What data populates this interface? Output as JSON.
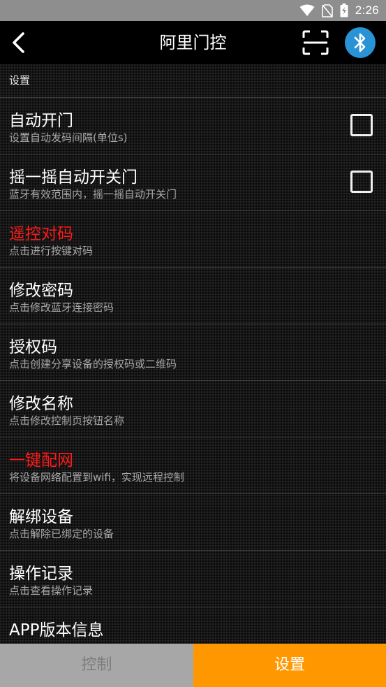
{
  "status_bar": {
    "time": "2:26",
    "icons": [
      "wifi-icon",
      "no-sim-icon",
      "battery-charging-icon"
    ]
  },
  "app_bar": {
    "title": "阿里门控",
    "back_icon": "back-arrow-icon",
    "scan_icon": "scan-icon",
    "bluetooth_icon": "bluetooth-icon"
  },
  "colors": {
    "accent_orange": "#ff9800",
    "bluetooth_blue": "#2a93d5",
    "highlight_red": "#ff1a1a"
  },
  "settings": {
    "section_label": "设置",
    "rows": [
      {
        "title": "自动开门",
        "subtitle": "设置自动发码间隔(单位s)",
        "checked": false
      },
      {
        "title": "摇一摇自动开关门",
        "subtitle": "蓝牙有效范围内，摇一摇自动开关门",
        "checked": false
      },
      {
        "title": "遥控对码",
        "subtitle": "点击进行按键对码"
      },
      {
        "title": "修改密码",
        "subtitle": "点击修改蓝牙连接密码"
      },
      {
        "title": "授权码",
        "subtitle": "点击创建分享设备的授权码或二维码"
      },
      {
        "title": "修改名称",
        "subtitle": "点击修改控制页按钮名称"
      },
      {
        "title": "一键配网",
        "subtitle": "将设备网络配置到wifi，实现远程控制"
      },
      {
        "title": "解绑设备",
        "subtitle": "点击解除已绑定的设备"
      },
      {
        "title": "操作记录",
        "subtitle": "点击查看操作记录"
      },
      {
        "title": "APP版本信息",
        "subtitle": ""
      }
    ]
  },
  "tabs": {
    "control": "控制",
    "settings": "设置",
    "active": "settings"
  }
}
